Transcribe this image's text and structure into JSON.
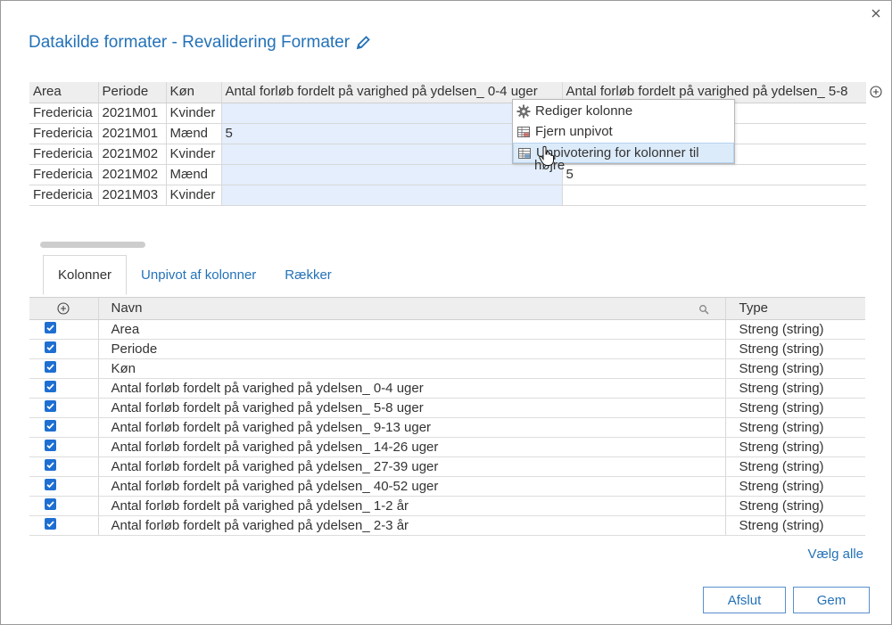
{
  "dialog": {
    "title": "Datakilde formater - Revalidering Formater",
    "close_symbol": "×"
  },
  "preview": {
    "headers": [
      "Area",
      "Periode",
      "Køn",
      "Antal forløb fordelt på varighed på ydelsen_ 0-4 uger",
      "Antal forløb fordelt på varighed på ydelsen_ 5-8"
    ],
    "rows": [
      [
        "Fredericia",
        "2021M01",
        "Kvinder",
        "",
        ""
      ],
      [
        "Fredericia",
        "2021M01",
        "Mænd",
        "5",
        ""
      ],
      [
        "Fredericia",
        "2021M02",
        "Kvinder",
        "",
        ""
      ],
      [
        "Fredericia",
        "2021M02",
        "Mænd",
        "",
        "5"
      ],
      [
        "Fredericia",
        "2021M03",
        "Kvinder",
        "",
        ""
      ]
    ]
  },
  "context_menu": {
    "items": [
      {
        "label": "Rediger kolonne",
        "icon": "gear-icon"
      },
      {
        "label": "Fjern unpivot",
        "icon": "table-icon"
      },
      {
        "label": "Unpivotering for kolonner til",
        "icon": "table-icon"
      }
    ],
    "wrap_text": "højre"
  },
  "tabs": [
    {
      "label": "Kolonner",
      "active": true
    },
    {
      "label": "Unpivot af kolonner",
      "active": false
    },
    {
      "label": "Rækker",
      "active": false
    }
  ],
  "columns_table": {
    "headers": {
      "name": "Navn",
      "type": "Type"
    },
    "rows": [
      {
        "name": "Area",
        "type": "Streng (string)",
        "checked": true
      },
      {
        "name": "Periode",
        "type": "Streng (string)",
        "checked": true
      },
      {
        "name": "Køn",
        "type": "Streng (string)",
        "checked": true
      },
      {
        "name": "Antal forløb fordelt på varighed på ydelsen_ 0-4 uger",
        "type": "Streng (string)",
        "checked": true
      },
      {
        "name": "Antal forløb fordelt på varighed på ydelsen_ 5-8 uger",
        "type": "Streng (string)",
        "checked": true
      },
      {
        "name": "Antal forløb fordelt på varighed på ydelsen_ 9-13 uger",
        "type": "Streng (string)",
        "checked": true
      },
      {
        "name": "Antal forløb fordelt på varighed på ydelsen_ 14-26 uger",
        "type": "Streng (string)",
        "checked": true
      },
      {
        "name": "Antal forløb fordelt på varighed på ydelsen_ 27-39 uger",
        "type": "Streng (string)",
        "checked": true
      },
      {
        "name": "Antal forløb fordelt på varighed på ydelsen_ 40-52 uger",
        "type": "Streng (string)",
        "checked": true
      },
      {
        "name": "Antal forløb fordelt på varighed på ydelsen_ 1-2 år",
        "type": "Streng (string)",
        "checked": true
      },
      {
        "name": "Antal forløb fordelt på varighed på ydelsen_ 2-3 år",
        "type": "Streng (string)",
        "checked": true
      }
    ]
  },
  "select_all_label": "Vælg alle",
  "buttons": {
    "close_label": "Afslut",
    "save_label": "Gem"
  },
  "colors": {
    "accent": "#2472b8",
    "selection": "#e4eefc",
    "checkbox": "#1e6fd1"
  }
}
